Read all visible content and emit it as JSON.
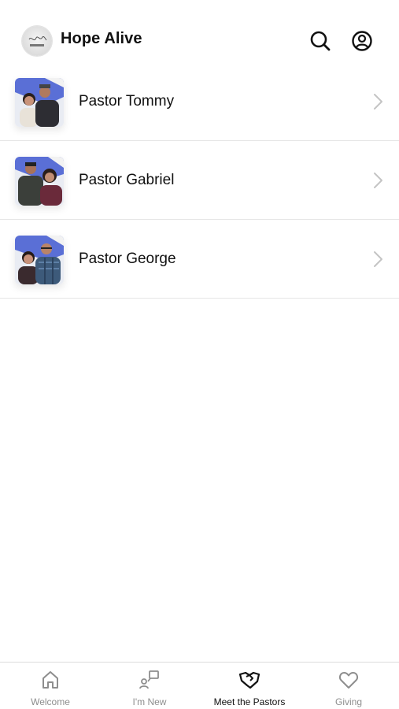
{
  "header": {
    "title": "Hope Alive",
    "logo_text": "Hope Alive",
    "search_icon": "search-icon",
    "profile_icon": "user-circle-icon"
  },
  "pastors": [
    {
      "name": "Pastor Tommy"
    },
    {
      "name": "Pastor Gabriel"
    },
    {
      "name": "Pastor George"
    }
  ],
  "tabs": [
    {
      "label": "Welcome",
      "icon": "home-icon",
      "active": false
    },
    {
      "label": "I'm New",
      "icon": "new-person-icon",
      "active": false
    },
    {
      "label": "Meet the Pastors",
      "icon": "handshake-icon",
      "active": true
    },
    {
      "label": "Giving",
      "icon": "heart-icon",
      "active": false
    }
  ],
  "colors": {
    "text": "#111111",
    "inactive_tab": "#8e8e8e",
    "divider": "#e6e6e6",
    "chevron": "#c4c4c4"
  }
}
